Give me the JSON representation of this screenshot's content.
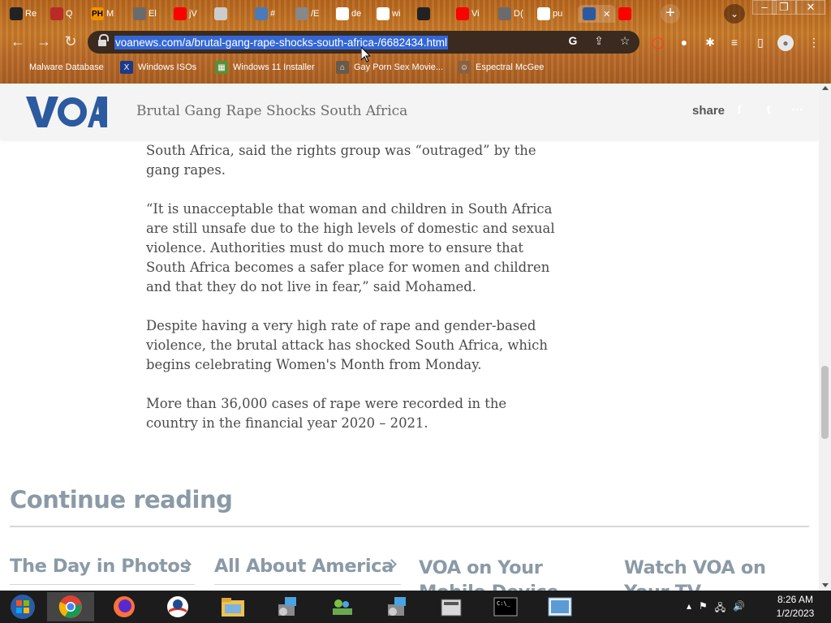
{
  "browser": {
    "tabs": [
      {
        "icon": "github-icon",
        "label": "Re",
        "color": "#222"
      },
      {
        "icon": "quora-icon",
        "label": "Q",
        "color": "#b92b27"
      },
      {
        "icon": "ph-icon",
        "label": "M",
        "color": "#f29100",
        "glyph": "PH"
      },
      {
        "icon": "globe-icon",
        "label": "El",
        "color": "#6b6b6b"
      },
      {
        "icon": "youtube-icon",
        "label": "jV",
        "color": "#ff0000"
      },
      {
        "icon": "loading-icon",
        "label": "",
        "color": "#ccc"
      },
      {
        "icon": "puzzle-icon",
        "label": "#",
        "color": "#4a7ab8"
      },
      {
        "icon": "grid-icon",
        "label": "/E",
        "color": "#888"
      },
      {
        "icon": "google-icon",
        "label": "de",
        "color": "#fff"
      },
      {
        "icon": "google-icon",
        "label": "wi",
        "color": "#fff"
      },
      {
        "icon": "record-icon",
        "label": "",
        "color": "#222"
      },
      {
        "icon": "youtube-icon",
        "label": "Vi",
        "color": "#ff0000"
      },
      {
        "icon": "globe-icon",
        "label": "D(",
        "color": "#6b6b6b"
      },
      {
        "icon": "google-icon",
        "label": "pu",
        "color": "#fff"
      },
      {
        "icon": "voa-icon",
        "label": "",
        "color": "#2c5aa0",
        "active": true
      },
      {
        "icon": "youtube-icon",
        "label": "",
        "color": "#ff0000"
      }
    ],
    "url": "voanews.com/a/brutal-gang-rape-shocks-south-africa-/6682434.html",
    "bookmarks": [
      {
        "label": "Malware Database",
        "icon": "bug-icon"
      },
      {
        "label": "Windows ISOs",
        "icon": "x-icon"
      },
      {
        "label": "Windows 11 Installer",
        "icon": "image-icon"
      },
      {
        "label": "Gay Porn Sex Movie...",
        "icon": "bookmark-icon"
      },
      {
        "label": "Espectral McGee",
        "icon": "face-icon"
      }
    ]
  },
  "site": {
    "logo_text": "VOA",
    "headline": "Brutal Gang Rape Shocks South Africa",
    "share_label": "share",
    "share_buttons": [
      {
        "name": "facebook",
        "glyph": "f",
        "color": "#1a3a6a"
      },
      {
        "name": "twitter",
        "glyph": "t",
        "color": "#1da1f2"
      },
      {
        "name": "more",
        "glyph": "···",
        "color": "#aaaaaa"
      }
    ]
  },
  "article": {
    "paragraphs": [
      "South Africa, said the rights group was “outraged” by the gang rapes.",
      "“It is unacceptable that woman and children in South Africa are still unsafe due to the high levels of domestic and sexual violence. Authorities must do much more to ensure that South Africa becomes a safer place for women and children and that they do not live in fear,” said Mohamed.",
      "Despite having a very high rate of rape and gender-based violence, the brutal attack has shocked South Africa, which begins celebrating Women's Month from Monday.",
      "More than 36,000 cases of rape were recorded in the country in the financial year 2020 – 2021."
    ]
  },
  "continue_reading": {
    "title": "Continue reading",
    "items": [
      "The Day in Photos",
      "All About America",
      "VOA on Your Mobile Device",
      "Watch VOA on Your TV"
    ]
  },
  "taskbar": {
    "apps": [
      "start-button",
      "chrome-icon",
      "firefox-icon",
      "obama-icon",
      "file-explorer-icon",
      "setup-icon",
      "people-icon",
      "installer-icon",
      "calculator-icon",
      "terminal-icon",
      "photo-icon"
    ],
    "clock_time": "8:26 AM",
    "clock_date": "1/2/2023"
  }
}
